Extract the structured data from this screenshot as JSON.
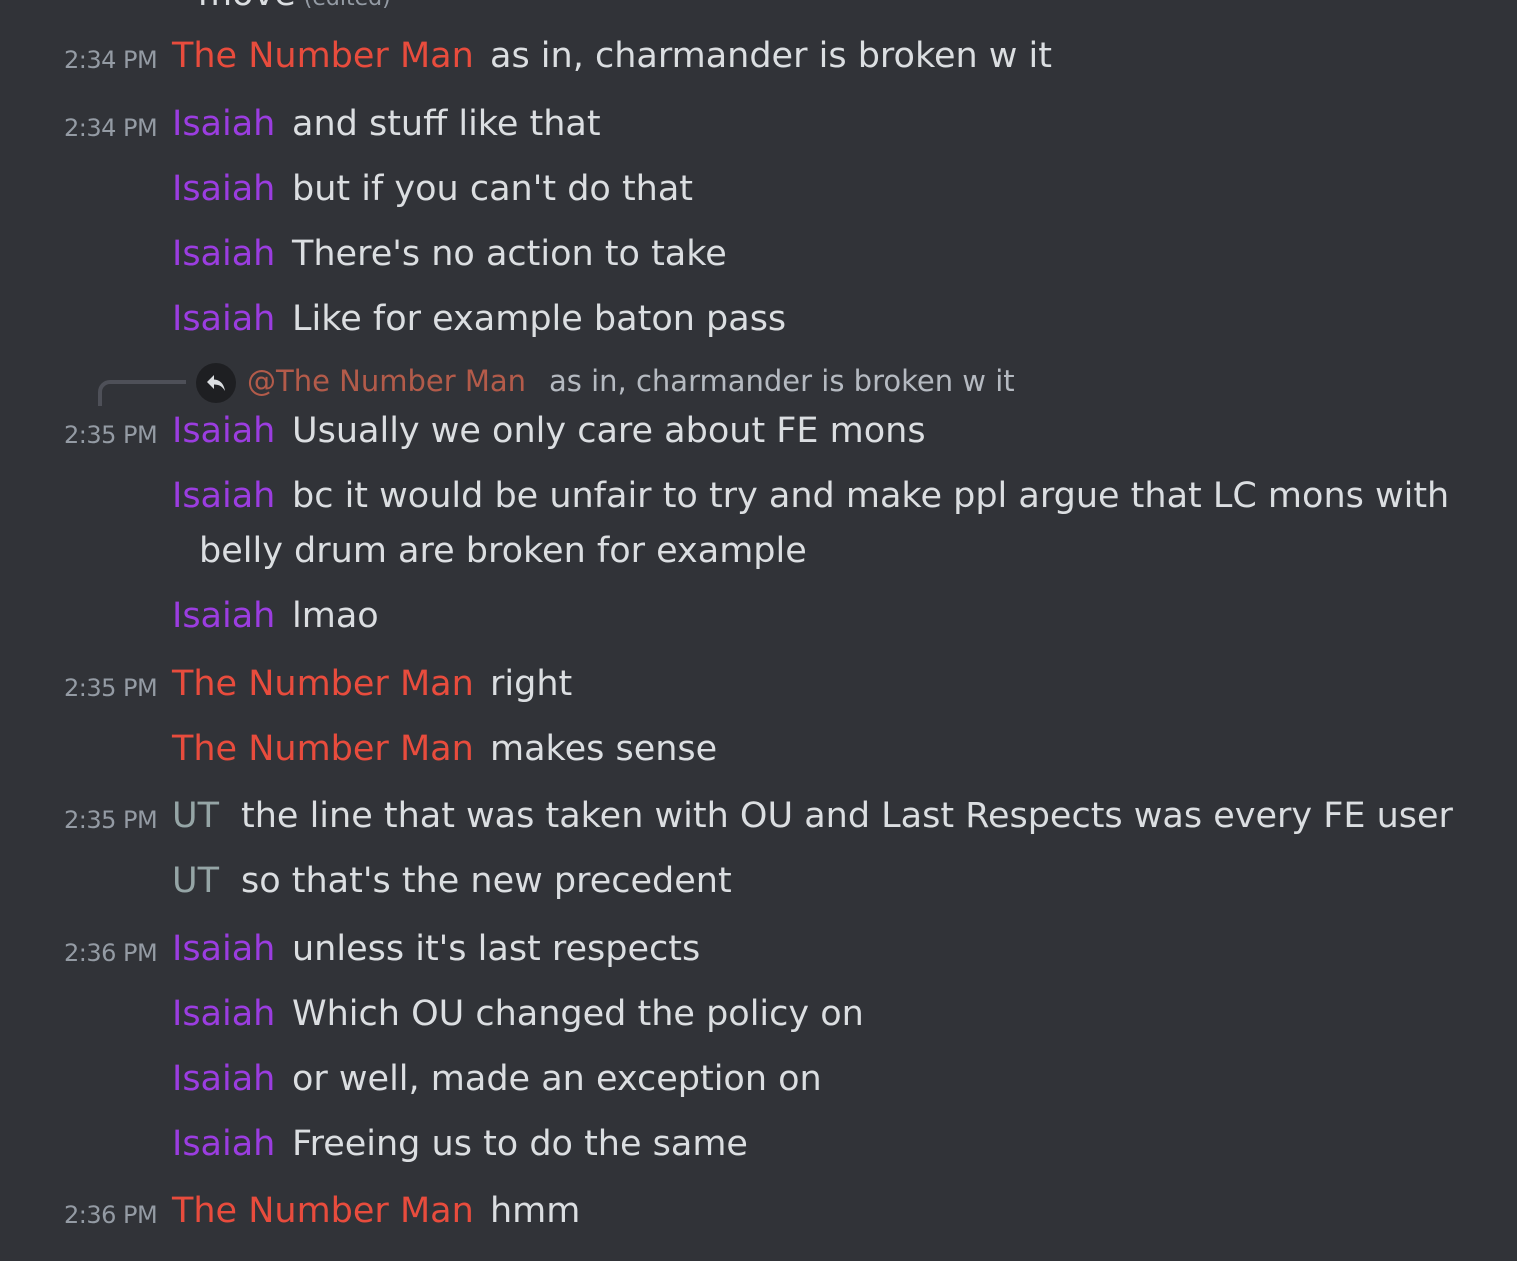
{
  "colors": {
    "background": "#313338",
    "timestamp": "#949ba4",
    "text": "#dbdee1",
    "number_man": "#e84c3d",
    "isaiah": "#9b3de0",
    "ut": "#95a5a6",
    "reply_mention": "#b35b4a"
  },
  "top_fragment": {
    "text": "move",
    "edited": "(edited)"
  },
  "reply": {
    "icon": "reply-arrow-icon",
    "mention": "@The Number Man",
    "text": "as in, charmander is broken w it"
  },
  "messages": [
    {
      "time": "2:34 PM",
      "author": "The Number Man",
      "text": "as in, charmander is broken w it"
    },
    {
      "time": "2:34 PM",
      "author": "Isaiah",
      "text": "and stuff like that"
    },
    {
      "time": "",
      "author": "Isaiah",
      "text": "but if you can't do that"
    },
    {
      "time": "",
      "author": "Isaiah",
      "text": "There's no action to take"
    },
    {
      "time": "",
      "author": "Isaiah",
      "text": "Like for example baton pass"
    },
    {
      "time": "2:35 PM",
      "author": "Isaiah",
      "text": "Usually we only care about FE mons"
    },
    {
      "time": "",
      "author": "Isaiah",
      "text": "bc it would be unfair to try and make ppl argue that LC mons with",
      "text_cont": "belly drum are broken for example"
    },
    {
      "time": "",
      "author": "Isaiah",
      "text": "lmao"
    },
    {
      "time": "2:35 PM",
      "author": "The Number Man",
      "text": "right"
    },
    {
      "time": "",
      "author": "The Number Man",
      "text": "makes sense"
    },
    {
      "time": "2:35 PM",
      "author": "UT",
      "text": "the line that was taken with OU and Last Respects was every FE user"
    },
    {
      "time": "",
      "author": "UT",
      "text": "so that's the new precedent"
    },
    {
      "time": "2:36 PM",
      "author": "Isaiah",
      "text": "unless it's last respects"
    },
    {
      "time": "",
      "author": "Isaiah",
      "text": "Which OU changed the policy on"
    },
    {
      "time": "",
      "author": "Isaiah",
      "text": "or well, made an exception on"
    },
    {
      "time": "",
      "author": "Isaiah",
      "text": "Freeing us to do the same"
    },
    {
      "time": "2:36 PM",
      "author": "The Number Man",
      "text": "hmm"
    }
  ]
}
